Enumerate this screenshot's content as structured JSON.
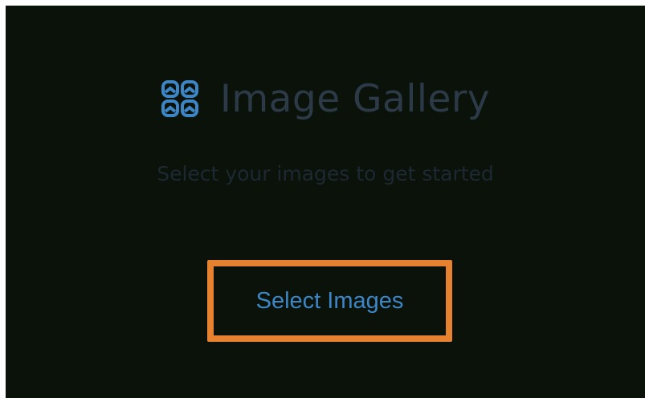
{
  "colors": {
    "background": "#0a120a",
    "title_text": "#2c3a48",
    "subtitle_text": "#1e2832",
    "accent_blue": "#3d86c6",
    "button_border": "#e6822f"
  },
  "header": {
    "icon": "gallery-grid-icon",
    "title": "Image Gallery"
  },
  "subtitle": "Select your images to get started",
  "actions": {
    "select_images_label": "Select Images"
  }
}
